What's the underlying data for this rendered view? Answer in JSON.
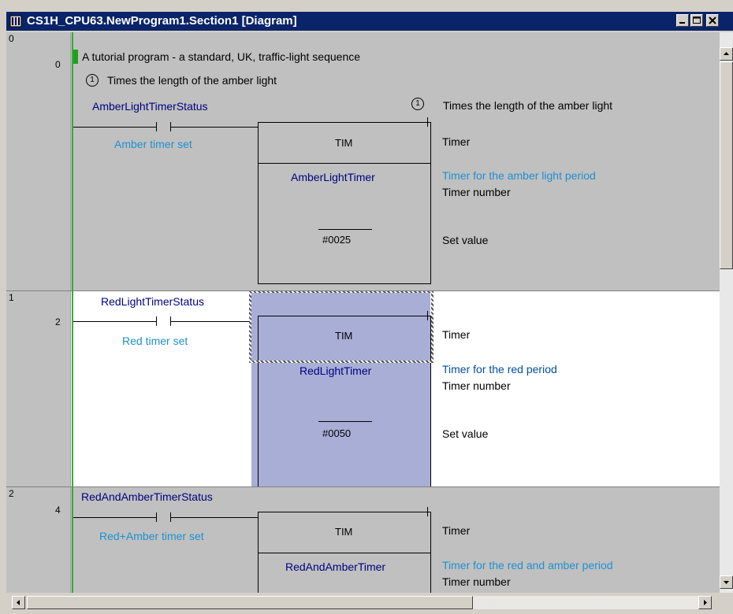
{
  "window": {
    "title": "CS1H_CPU63.NewProgram1.Section1 [Diagram]"
  },
  "program_comment": "A tutorial program - a standard, UK, traffic-light sequence",
  "rungs": [
    {
      "rung_index": "0",
      "step_index": "0",
      "rung_comment_num": "1",
      "rung_comment": "Times the length of the amber light",
      "contact_name": "AmberLightTimerStatus",
      "contact_comment": "Amber timer set",
      "instr_comment_num": "1",
      "instr_comment": "Times the length of the amber light",
      "instruction": "TIM",
      "instruction_desc": "Timer",
      "operand1": "AmberLightTimer",
      "operand1_comment": "Timer for the amber light period",
      "operand1_desc": "Timer number",
      "operand2": "#0025",
      "operand2_desc": "Set value"
    },
    {
      "rung_index": "1",
      "step_index": "2",
      "contact_name": "RedLightTimerStatus",
      "contact_comment": "Red timer set",
      "instruction": "TIM",
      "instruction_desc": "Timer",
      "operand1": "RedLightTimer",
      "operand1_comment": "Timer for the red period",
      "operand1_desc": "Timer number",
      "operand2": "#0050",
      "operand2_desc": "Set value"
    },
    {
      "rung_index": "2",
      "step_index": "4",
      "contact_name": "RedAndAmberTimerStatus",
      "contact_comment": "Red+Amber timer set",
      "instruction": "TIM",
      "instruction_desc": "Timer",
      "operand1": "RedAndAmberTimer",
      "operand1_comment": "Timer for the red and amber period",
      "operand1_desc": "Timer number"
    }
  ],
  "colors": {
    "title_bar": "#0a246a",
    "rail": "#3aa83a",
    "selection": "#a9aed6",
    "comment_blue": "#000080",
    "comment_cyan": "#1e90d0"
  },
  "icons": [
    "app-icon",
    "minimize-icon",
    "maximize-icon",
    "close-icon",
    "scroll-up-icon",
    "scroll-down-icon",
    "scroll-left-icon",
    "scroll-right-icon"
  ]
}
